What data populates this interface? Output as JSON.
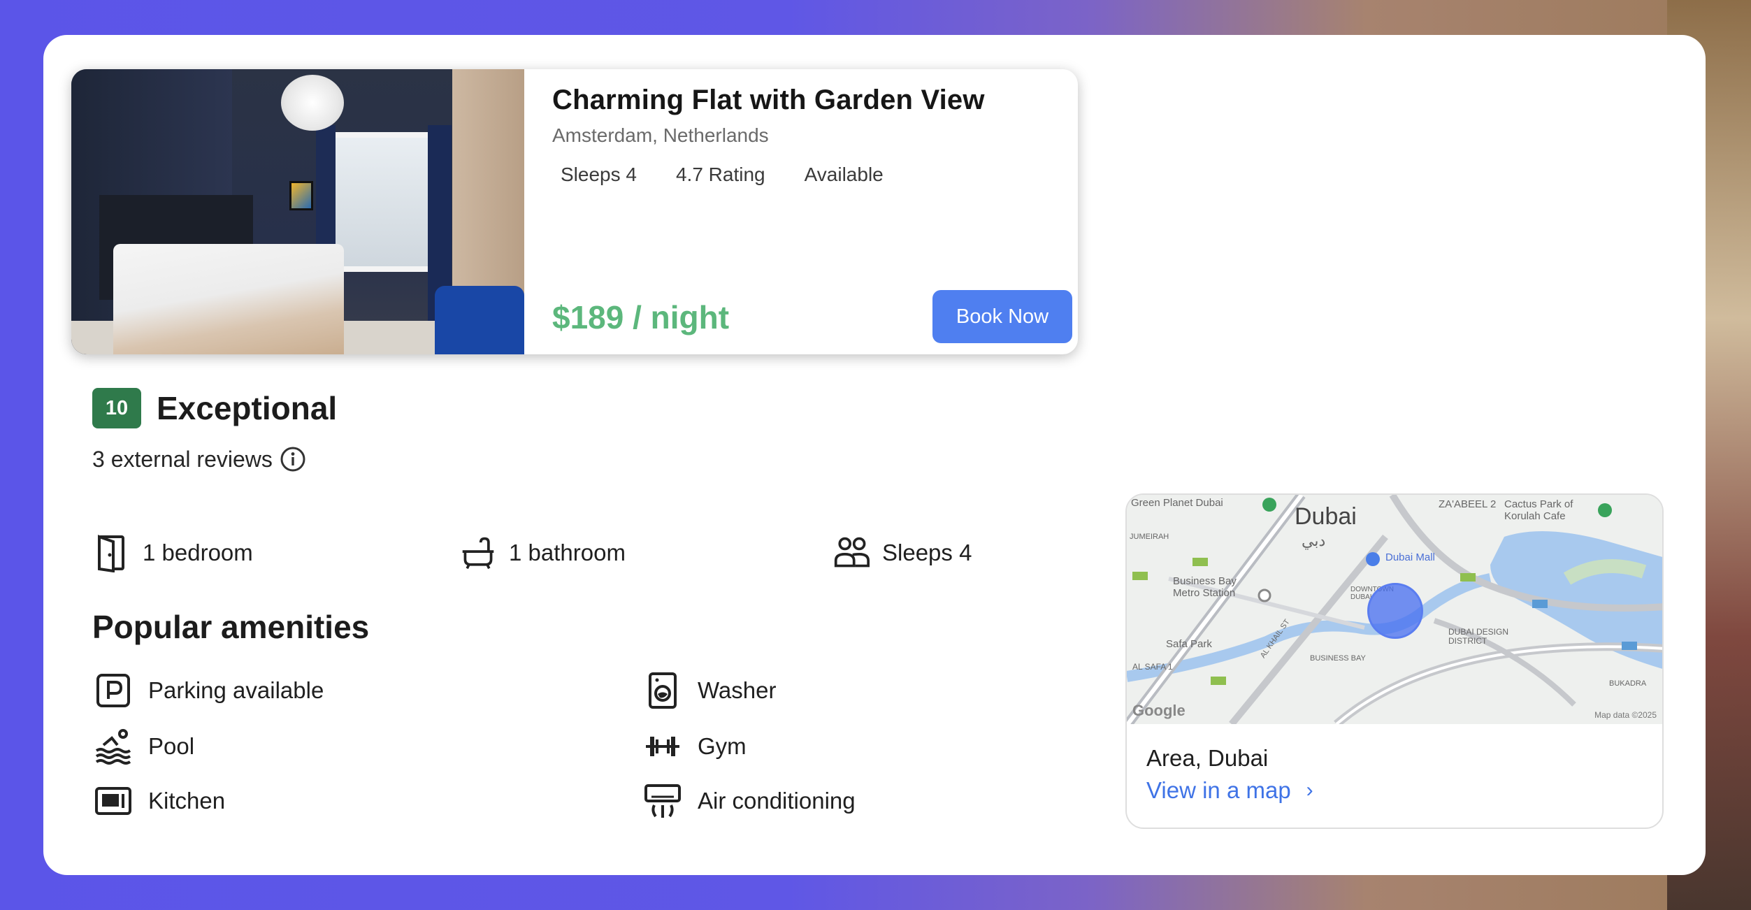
{
  "listing": {
    "title": "Charming Flat with Garden View",
    "location": "Amsterdam, Netherlands",
    "meta": [
      "Sleeps 4",
      "4.7 Rating",
      "Available"
    ],
    "price": "$189 / night",
    "book_label": "Book Now"
  },
  "rating": {
    "score": "10",
    "label": "Exceptional",
    "reviews": "3 external reviews"
  },
  "features": {
    "bedroom": "1 bedroom",
    "bathroom": "1 bathroom",
    "sleeps": "Sleeps 4"
  },
  "amenities": {
    "title": "Popular amenities",
    "parking": "Parking available",
    "pool": "Pool",
    "kitchen": "Kitchen",
    "washer": "Washer",
    "gym": "Gym",
    "ac": "Air conditioning"
  },
  "map": {
    "city": "Dubai",
    "city_ar": "دبي",
    "poi_green_planet": "Green Planet Dubai",
    "poi_zabeel": "ZA'ABEEL 2",
    "poi_cactus": "Cactus Park of Korulah Cafe",
    "poi_jumeirah": "JUMEIRAH",
    "poi_business_bay": "Business Bay Metro Station",
    "poi_dubai_mall": "Dubai Mall",
    "poi_downtown": "DOWNTOWN DUBAI",
    "poi_safa_park": "Safa Park",
    "poi_al_safa": "AL SAFA 1",
    "poi_design": "DUBAI DESIGN DISTRICT",
    "poi_al_khail": "AL KHAIL ST",
    "poi_business_bay2": "BUSINESS BAY",
    "poi_bukadra": "BUKADRA",
    "google": "Google",
    "copyright": "Map data ©2025",
    "area_label": "Area, Dubai",
    "link_label": "View in a map",
    "link_chevron": "›"
  },
  "colors": {
    "price": "#5cb77c",
    "button": "#4f7ff0",
    "badge": "#2f7a4b",
    "link": "#3f73e6"
  }
}
